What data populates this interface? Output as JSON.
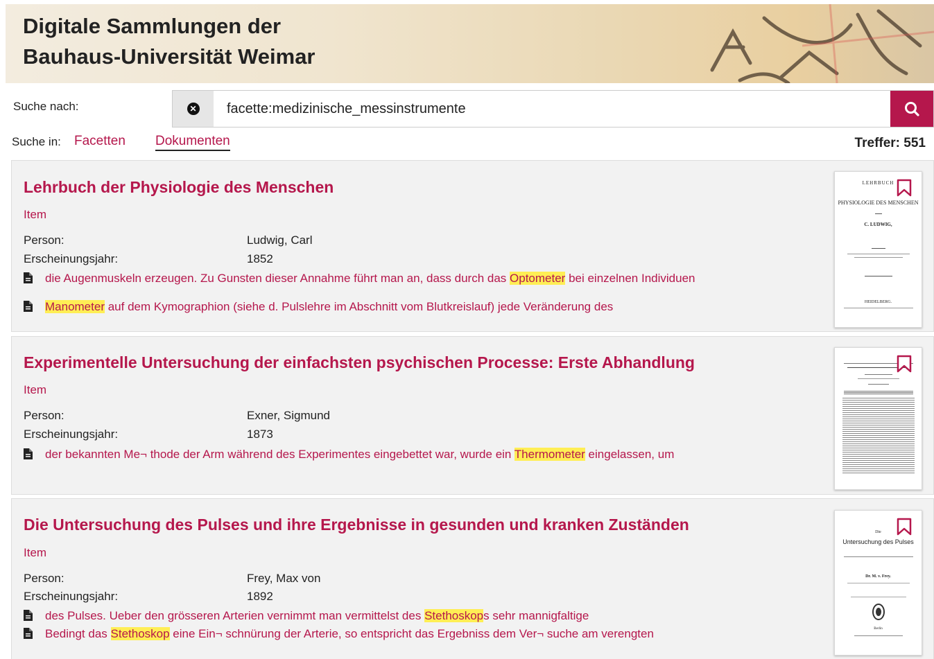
{
  "header": {
    "title_line1": "Digitale Sammlungen der",
    "title_line2": "Bauhaus-Universität Weimar"
  },
  "search": {
    "label": "Suche nach:",
    "value": "facette:medizinische_messinstrumente",
    "clear_icon": "times-circle-icon",
    "search_icon": "magnifier-icon"
  },
  "scope": {
    "label": "Suche in:",
    "tabs": [
      {
        "label": "Facetten",
        "active": false
      },
      {
        "label": "Dokumenten",
        "active": true
      }
    ],
    "hits": "Treffer: 551"
  },
  "results": [
    {
      "title": "Lehrbuch der Physiologie des Menschen",
      "type": "Item",
      "person_label": "Person:",
      "person": "Ludwig, Carl",
      "year_label": "Erscheinungsjahr:",
      "year": "1852",
      "snippets": [
        {
          "before": "die Augenmuskeln erzeugen. Zu Gunsten dieser Annahme führt man an, dass durch das ",
          "hit": "Optometer",
          "after": " bei einzelnen Individuen"
        },
        {
          "before": "",
          "hit": "Manometer",
          "after": " auf dem Kymographion (siehe d. Pulslehre im Abschnitt vom Blutkreislauf) jede Veränderung des"
        }
      ],
      "thumb": {
        "l1": "LEHRBUCH",
        "l2": "PHYSIOLOGIE DES MENSCHEN",
        "l3": "C. LUDWIG,",
        "l4": "HEIDELBERG."
      }
    },
    {
      "title": "Experimentelle Untersuchung der einfachsten psychischen Processe: Erste Abhandlung",
      "type": "Item",
      "person_label": "Person:",
      "person": "Exner, Sigmund",
      "year_label": "Erscheinungsjahr:",
      "year": "1873",
      "snippets": [
        {
          "before": "der bekannten Me¬ thode der Arm während des Experimentes eingebettet war, wurde ein ",
          "hit": "Thermometer",
          "after": " eingelassen, um"
        }
      ]
    },
    {
      "title": "Die Untersuchung des Pulses und ihre Ergebnisse in gesunden und kranken Zuständen",
      "type": "Item",
      "person_label": "Person:",
      "person": "Frey, Max von",
      "year_label": "Erscheinungsjahr:",
      "year": "1892",
      "snippets": [
        {
          "before": "des Pulses. Ueber den grösseren Arterien vernimmt man vermittelst des ",
          "hit": "Stethoskop",
          "after": "s sehr mannigfaltige"
        },
        {
          "before": "Bedingt das ",
          "hit": "Stethoskop",
          "after": " eine Ein¬ schnürung der Arterie, so entspricht das Ergebniss dem Ver¬ suche am verengten"
        }
      ],
      "thumb": {
        "l1": "Die",
        "l2": "Untersuchung des Pulses",
        "l3": "Dr. M. v. Frey.",
        "l4": "Berlin"
      }
    }
  ],
  "colors": {
    "accent": "#b5174c",
    "highlight": "#ffee55",
    "card_bg": "#f2f2f2"
  }
}
